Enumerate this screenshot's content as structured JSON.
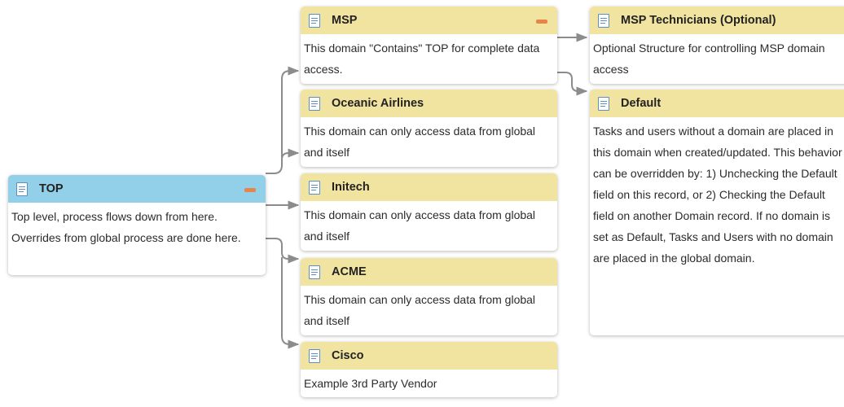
{
  "colors": {
    "yellow_header": "#f1e4a1",
    "blue_header": "#92cfe9",
    "collapse_button": "#e8834a",
    "connector": "#8c8c8c",
    "doc_icon": "#5a8fc9"
  },
  "nodes": {
    "top": {
      "title": "TOP",
      "description": "Top level, process flows down from here. Overrides from global process are done here.",
      "icon": "document-icon",
      "header_color": "blue",
      "collapsible": true
    },
    "msp": {
      "title": "MSP",
      "description": "This domain \"Contains\" TOP for complete data access.",
      "icon": "document-icon",
      "header_color": "yellow",
      "collapsible": true
    },
    "oceanic": {
      "title": "Oceanic Airlines",
      "description": "This domain can only access data from global and itself",
      "icon": "document-icon",
      "header_color": "yellow",
      "collapsible": false
    },
    "initech": {
      "title": "Initech",
      "description": "This domain can only access data from global and itself",
      "icon": "document-icon",
      "header_color": "yellow",
      "collapsible": false
    },
    "acme": {
      "title": "ACME",
      "description": "This domain can only access data from global and itself",
      "icon": "document-icon",
      "header_color": "yellow",
      "collapsible": false
    },
    "cisco": {
      "title": "Cisco",
      "description": "Example 3rd Party Vendor",
      "icon": "document-icon",
      "header_color": "yellow",
      "collapsible": false
    },
    "msp_technicians": {
      "title": "MSP Technicians (Optional)",
      "description": "Optional Structure for controlling MSP domain access",
      "icon": "document-icon",
      "header_color": "yellow",
      "collapsible": false
    },
    "default": {
      "title": "Default",
      "description": "Tasks and users without a domain are placed in this domain when created/updated. This behavior can be overridden by: 1) Unchecking the Default field on this record, or 2) Checking the Default field on another Domain record. If no domain is set as Default, Tasks and Users with no domain are placed in the global domain.",
      "icon": "document-icon",
      "header_color": "yellow",
      "collapsible": false
    }
  },
  "edges": [
    {
      "from": "top",
      "to": "msp"
    },
    {
      "from": "top",
      "to": "oceanic"
    },
    {
      "from": "top",
      "to": "initech"
    },
    {
      "from": "top",
      "to": "acme"
    },
    {
      "from": "top",
      "to": "cisco"
    },
    {
      "from": "msp",
      "to": "msp_technicians"
    },
    {
      "from": "msp",
      "to": "default"
    }
  ]
}
